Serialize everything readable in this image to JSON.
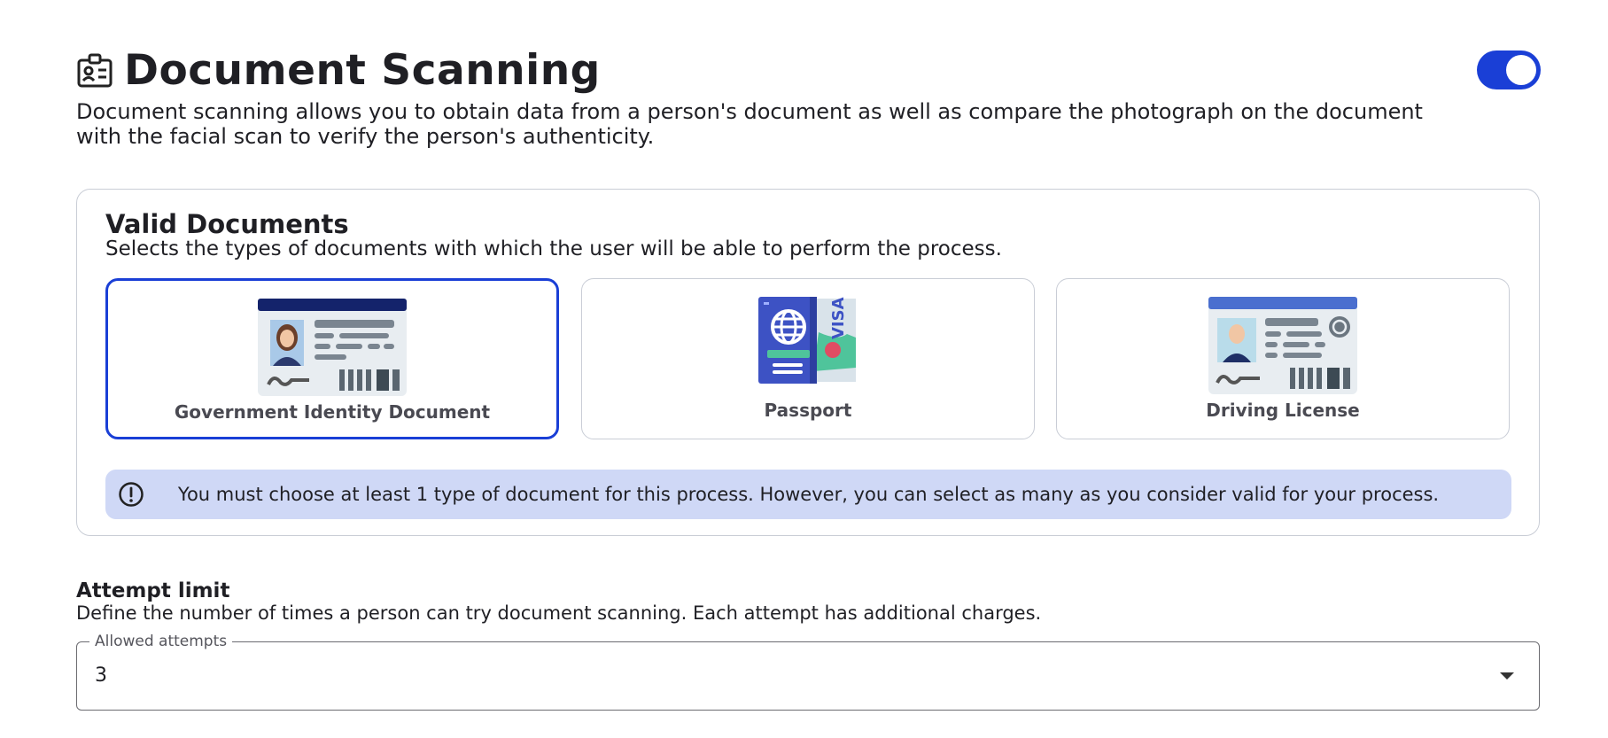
{
  "header": {
    "title": "Document Scanning",
    "icon": "id-badge-icon",
    "toggle_enabled": true,
    "description": "Document scanning allows you to obtain data from a person's document as well as compare the photograph on the document with the facial scan to verify the person's authenticity."
  },
  "valid_documents": {
    "title": "Valid Documents",
    "subtitle": "Selects the types of documents with which the user will be able to perform the process.",
    "options": [
      {
        "label": "Government Identity Document",
        "icon": "government-id-icon",
        "selected": true
      },
      {
        "label": "Passport",
        "icon": "passport-icon",
        "selected": false
      },
      {
        "label": "Driving License",
        "icon": "driving-license-icon",
        "selected": false
      }
    ],
    "notice": {
      "icon": "exclamation-circle-icon",
      "text": "You must choose at least 1 type of document for this process. However, you can select as many as you consider valid for your process."
    }
  },
  "attempt_limit": {
    "title": "Attempt limit",
    "description": "Define the number of times a person can try document scanning. Each attempt has additional charges.",
    "field_label": "Allowed attempts",
    "value": "3"
  },
  "colors": {
    "accent": "#1a3fd6",
    "notice_bg": "#cfd8f6",
    "border": "#c9cdd6"
  }
}
